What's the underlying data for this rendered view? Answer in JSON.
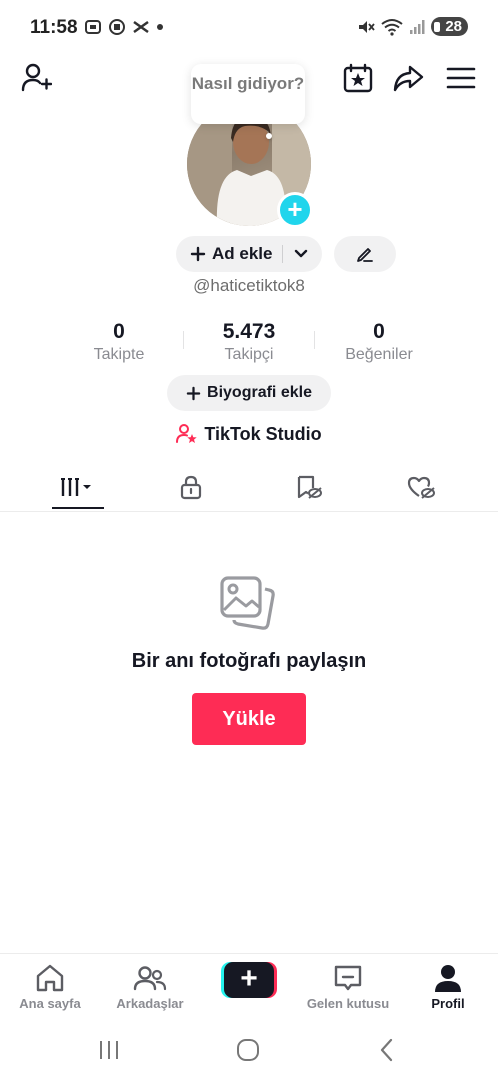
{
  "status_bar": {
    "time": "11:58",
    "battery": "28",
    "left_icons": [
      "screenshot-icon",
      "record-icon",
      "capcut-icon",
      "dot-icon"
    ],
    "right_icons": [
      "mute-icon",
      "wifi-icon",
      "signal-icon",
      "battery-icon"
    ]
  },
  "header": {
    "left_icon": "add-friend-icon",
    "right_icons": [
      "calendar-star-icon",
      "share-icon",
      "menu-icon"
    ]
  },
  "profile": {
    "bubble_text": "Nasıl gidiyor?",
    "add_name_label": "Ad ekle",
    "username": "@haticetiktok8",
    "stats": [
      {
        "value": "0",
        "label": "Takipte"
      },
      {
        "value": "5.473",
        "label": "Takipçi"
      },
      {
        "value": "0",
        "label": "Beğeniler"
      }
    ],
    "bio_button": "Biyografi ekle",
    "studio_label": "TikTok Studio"
  },
  "tabs": [
    {
      "icon": "grid-videos-icon",
      "active": true
    },
    {
      "icon": "lock-icon",
      "active": false
    },
    {
      "icon": "bookmark-hidden-icon",
      "active": false
    },
    {
      "icon": "heart-hidden-icon",
      "active": false
    }
  ],
  "empty_state": {
    "icon": "photos-icon",
    "title": "Bir anı fotoğrafı paylaşın",
    "button": "Yükle"
  },
  "bottom_nav": {
    "items": [
      {
        "label": "Ana sayfa",
        "icon": "home-icon"
      },
      {
        "label": "Arkadaşlar",
        "icon": "friends-icon"
      },
      {
        "label": "",
        "icon": "create-icon"
      },
      {
        "label": "Gelen kutusu",
        "icon": "inbox-icon"
      },
      {
        "label": "Profil",
        "icon": "profile-icon"
      }
    ]
  },
  "colors": {
    "accent_red": "#fe2c55",
    "accent_cyan": "#20d5ec",
    "text_primary": "#161823",
    "text_secondary": "#8a8b91"
  }
}
